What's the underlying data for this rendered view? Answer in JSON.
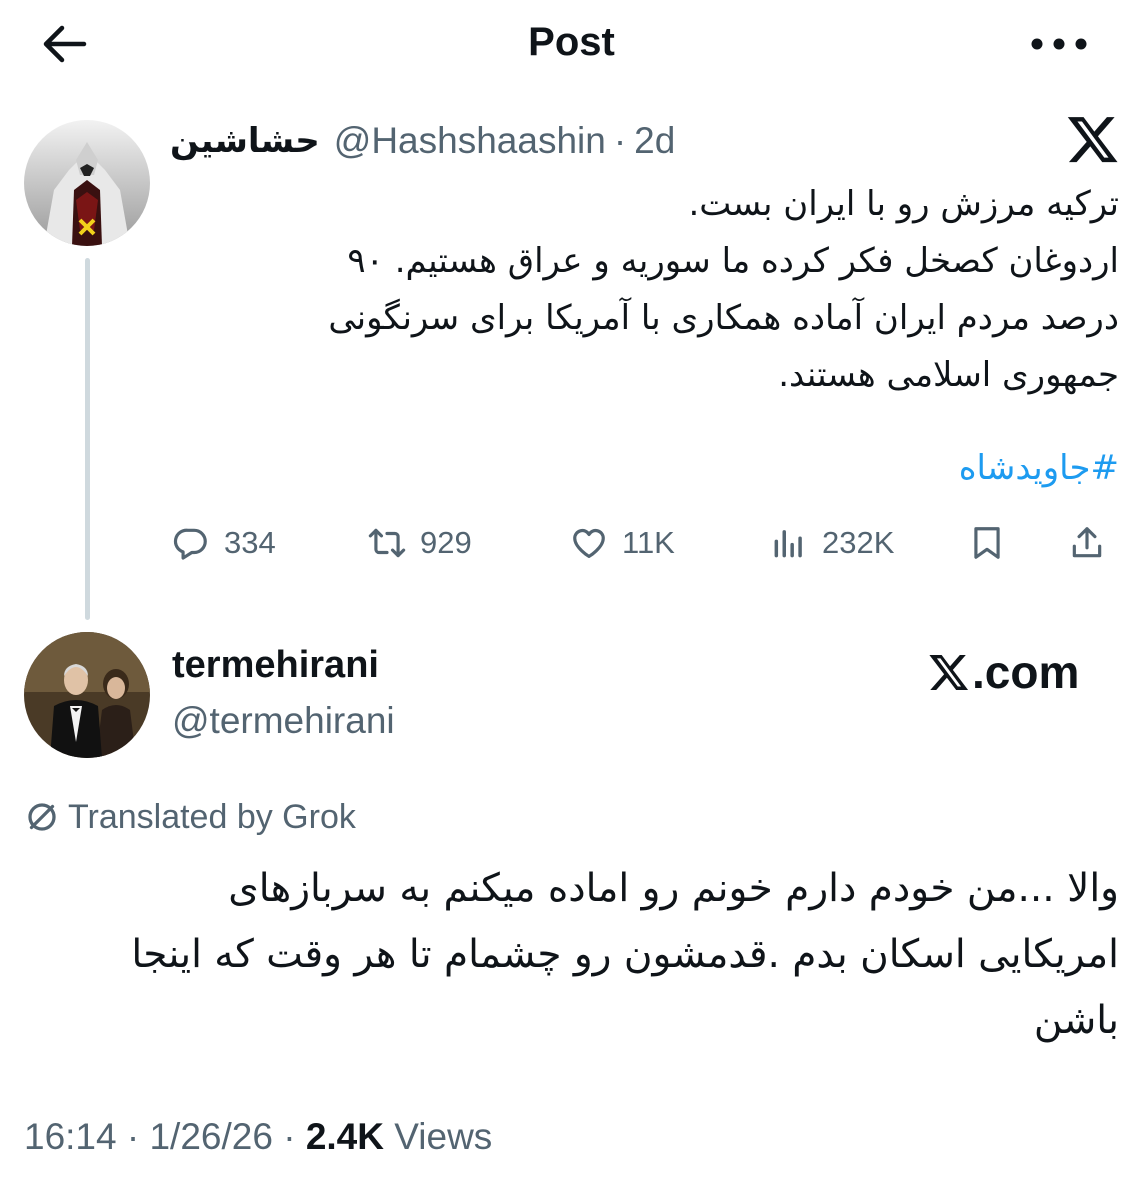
{
  "header": {
    "title": "Post",
    "back_icon": "arrow-left-icon",
    "more_icon": "more-horizontal-icon"
  },
  "quoted_post": {
    "display_name": "حشاشین",
    "handle": "@Hashshaashin",
    "separator": "·",
    "time": "2d",
    "lines": [
      "ترکیه مرزش رو با ایران بست.",
      "اردوغان کصخل فکر کرده ما سوریه و عراق هستیم. ۹۰",
      "درصد مردم ایران آماده همکاری با آمریکا برای سرنگونی",
      "جمهوری اسلامی هستند."
    ],
    "hashtag": "#جاویدشاه",
    "metrics": {
      "replies": "334",
      "reposts": "929",
      "likes": "11K",
      "views": "232K"
    }
  },
  "post": {
    "display_name": "termehirani",
    "handle": "@termehirani",
    "watermark": ".com",
    "translated_label": "Translated by Grok",
    "lines": [
      "والا ...من خودم دارم خونم رو اماده میکنم به سربازهای",
      "امریکایی اسکان بدم .قدمشون رو چشمام تا هر وقت که اینجا",
      "باشن"
    ],
    "time": "16:14",
    "date": "1/26/26",
    "separator": "·",
    "views_count": "2.4K",
    "views_label": "Views"
  },
  "colors": {
    "accent": "#1d9bf0",
    "secondary_text": "#536471",
    "primary_text": "#0f1419",
    "thread_line": "#cfd9de"
  }
}
